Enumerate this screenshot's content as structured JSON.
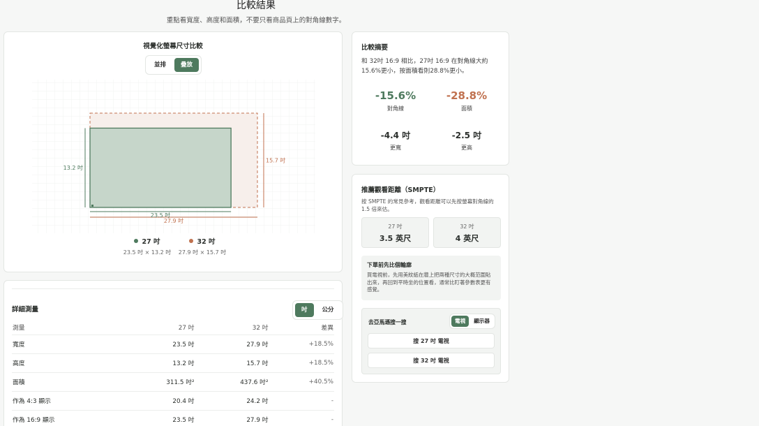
{
  "header": {
    "title": "比較結果",
    "subtitle": "重點看寬度、高度和面積，不要只看商品頁上的對角線數字。"
  },
  "visual": {
    "title": "視覺化螢幕尺寸比較",
    "view_toggle": {
      "options": [
        "並排",
        "疊放"
      ],
      "selected": "疊放"
    },
    "screen_a": {
      "name": "27 吋",
      "dims": "23.5 吋 × 13.2 吋",
      "width_label": "23.5 吋",
      "height_label": "13.2 吋",
      "width": 23.5,
      "height": 13.2,
      "color": "#4e7a5e"
    },
    "screen_b": {
      "name": "32 吋",
      "dims": "27.9 吋 × 15.7 吋",
      "width_label": "27.9 吋",
      "height_label": "15.7 吋",
      "width": 27.9,
      "height": 15.7,
      "color": "#c0714f"
    }
  },
  "table": {
    "title": "詳細測量",
    "unit_toggle": {
      "options": [
        "吋",
        "公分"
      ],
      "selected": "吋"
    },
    "headers": [
      "測量",
      "27 吋",
      "32 吋",
      "差異"
    ],
    "rows": [
      [
        "寬度",
        "23.5 吋",
        "27.9 吋",
        "+18.5%"
      ],
      [
        "高度",
        "13.2 吋",
        "15.7 吋",
        "+18.5%"
      ],
      [
        "面積",
        "311.5 吋²",
        "437.6 吋²",
        "+40.5%"
      ],
      [
        "作為 4:3 顯示",
        "20.4 吋",
        "24.2 吋",
        "-"
      ],
      [
        "作為 16:9 顯示",
        "23.5 吋",
        "27.9 吋",
        "-"
      ]
    ]
  },
  "summary": {
    "title": "比較摘要",
    "text": "和 32吋 16:9 相比，27吋 16:9 在對角線大約 15.6%更小，按面積看則28.8%更小。",
    "stats": [
      {
        "value": "-15.6%",
        "label": "對角線",
        "color": "#4e7a5e"
      },
      {
        "value": "-28.8%",
        "label": "面積",
        "color": "#c0714f"
      },
      {
        "value": "-4.4 吋",
        "label": "更寬",
        "color": "#2b2f2c"
      },
      {
        "value": "-2.5 吋",
        "label": "更高",
        "color": "#2b2f2c"
      }
    ]
  },
  "distance": {
    "title": "推薦觀看距離（SMPTE）",
    "text": "按 SMPTE 的常見參考，觀看距離可以先按螢幕對角線的 1.5 倍來估。",
    "boxes": [
      {
        "size": "27 吋",
        "distance": "3.5 英尺"
      },
      {
        "size": "32 吋",
        "distance": "4 英尺"
      }
    ],
    "tip_title": "下單前先比個輪廓",
    "tip_text": "買電視前，先用美紋紙在牆上把兩種尺寸的大概范圍貼出來，再回到平時坐的位置看，通常比盯著參數表更有感覺。",
    "shop": {
      "title": "去亞馬遜搜一搜",
      "type_toggle": {
        "options": [
          "電視",
          "顯示器"
        ],
        "selected": "電視"
      },
      "buttons": [
        "搜 27 吋 電視",
        "搜 32 吋 電視"
      ]
    }
  }
}
